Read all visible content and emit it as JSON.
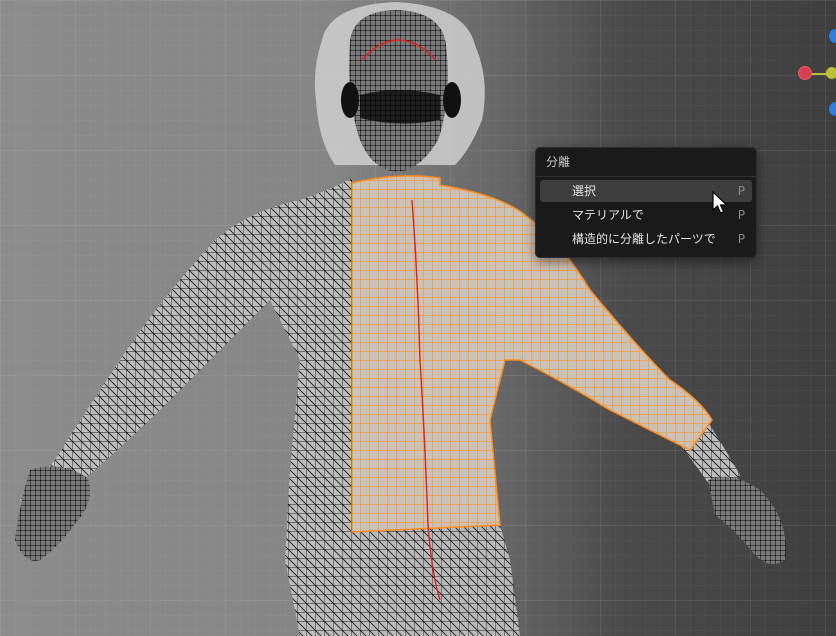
{
  "menu": {
    "title": "分離",
    "items": [
      {
        "label": "選択",
        "shortcut": "P",
        "active": true
      },
      {
        "label": "マテリアルで",
        "shortcut": "P",
        "active": false
      },
      {
        "label": "構造的に分離したパーツで",
        "shortcut": "P",
        "active": false
      }
    ]
  },
  "colors": {
    "selection": "#ff8c1a",
    "wire": "#111111",
    "seam": "#e0201e",
    "menu_bg": "#1a1a1a",
    "gizmo_x": "#d6404f",
    "gizmo_y": "#b8c236",
    "gizmo_z": "#2f7ee0"
  },
  "icons": [
    "mouse-pointer-icon",
    "axis-x-icon",
    "axis-y-icon",
    "axis-z-icon"
  ]
}
